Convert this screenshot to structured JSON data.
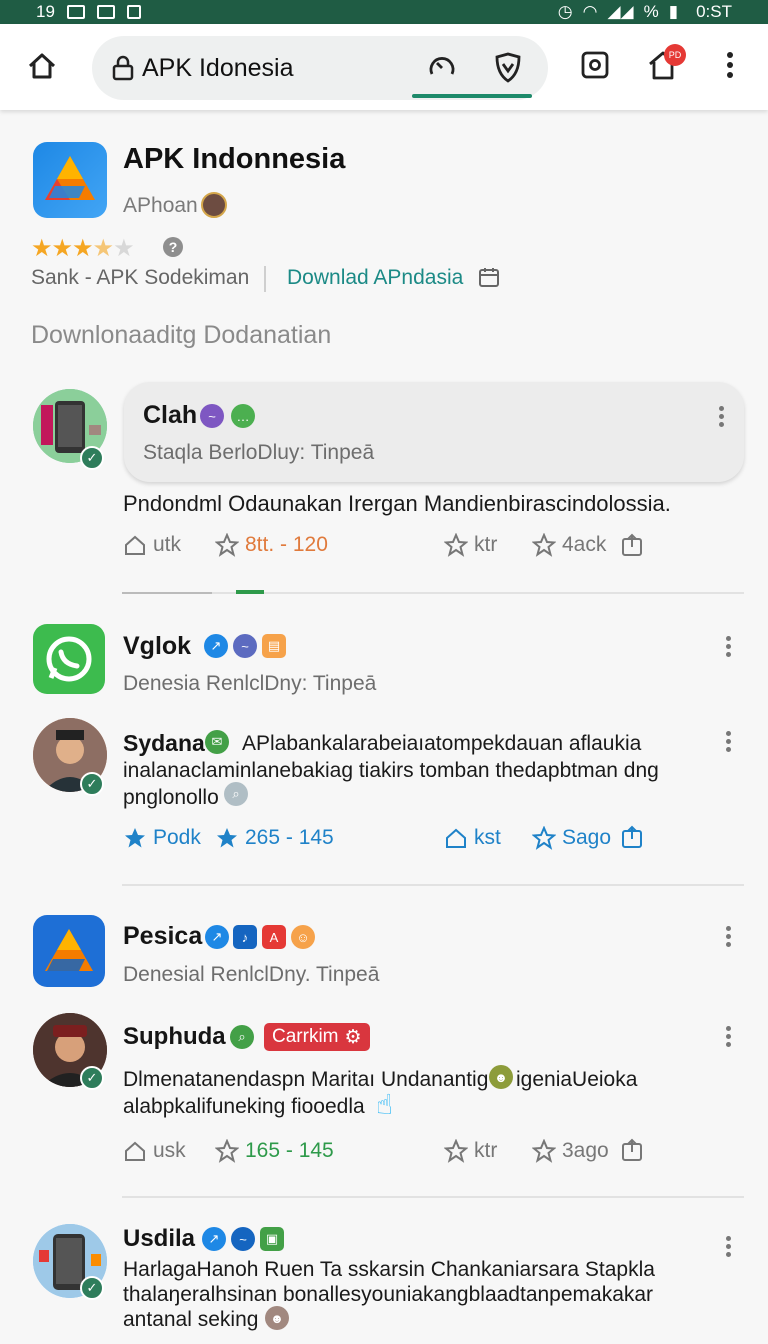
{
  "status_bar": {
    "time_left": "19",
    "battery": "%",
    "clock": "0:ST"
  },
  "browser": {
    "url": "APK Idonesia",
    "notification_badge": "PD"
  },
  "app": {
    "title": "APK Indonnesia",
    "developer": "APhoan",
    "rating_stars": 3.5,
    "rank_text": "Sank - APK Sodekiman",
    "download_link": "Downlad APndasia",
    "section_title": "Downlonaaditg Dodanatian"
  },
  "feed": [
    {
      "name": "Clah",
      "subtitle": "Staqla BerloDluy: Tinpeā",
      "body": "Pndondml Odaunakan Irergan Mandienbirascindolossia.",
      "actions": {
        "a1": "utk",
        "a2": "8tt. - 120",
        "a3": "ktr",
        "a4": "4ack"
      }
    },
    {
      "name": "Vglok",
      "subtitle": "Denesia RenlclDny: Tinpeā"
    },
    {
      "name": "Sydana",
      "body_line1": "APlabankalarabeiaıatompekdauan aflaukia",
      "body_line2": "inalanaclaminlanebakiag tiakirs tomban thedapbtman  dng",
      "body_line3": "pnglonollo",
      "actions": {
        "a1": "Podk",
        "a2": "265 - 145",
        "a3": "kst",
        "a4": "Sago"
      }
    },
    {
      "name": "Pesica",
      "subtitle": "Denesial RenlclDny. Tinpeā"
    },
    {
      "name": "Suphuda",
      "tag": "Carrkim",
      "body_line1": "Dlmenatanendaspn Maritaı Undanantig",
      "body_line1b": "igeniaUeioka",
      "body_line2": "alabpkalifuneking fiooedla",
      "actions": {
        "a1": "usk",
        "a2": "165 - 145",
        "a3": "ktr",
        "a4": "3ago"
      }
    },
    {
      "name": "Usdila",
      "body_line1": "HarlagaHanoh Ruen Ta sskarsin Chankaniarsara Stapkla",
      "body_line2": "thalaŋeralhsinan bonallesyouniakangblaadtanpemakakar",
      "body_line3": "antanal seking"
    }
  ],
  "colors": {
    "status_bar": "#1f5c44",
    "accent_teal": "#1c8a86",
    "star": "#f5a623",
    "progress": "#1d8a6a"
  }
}
